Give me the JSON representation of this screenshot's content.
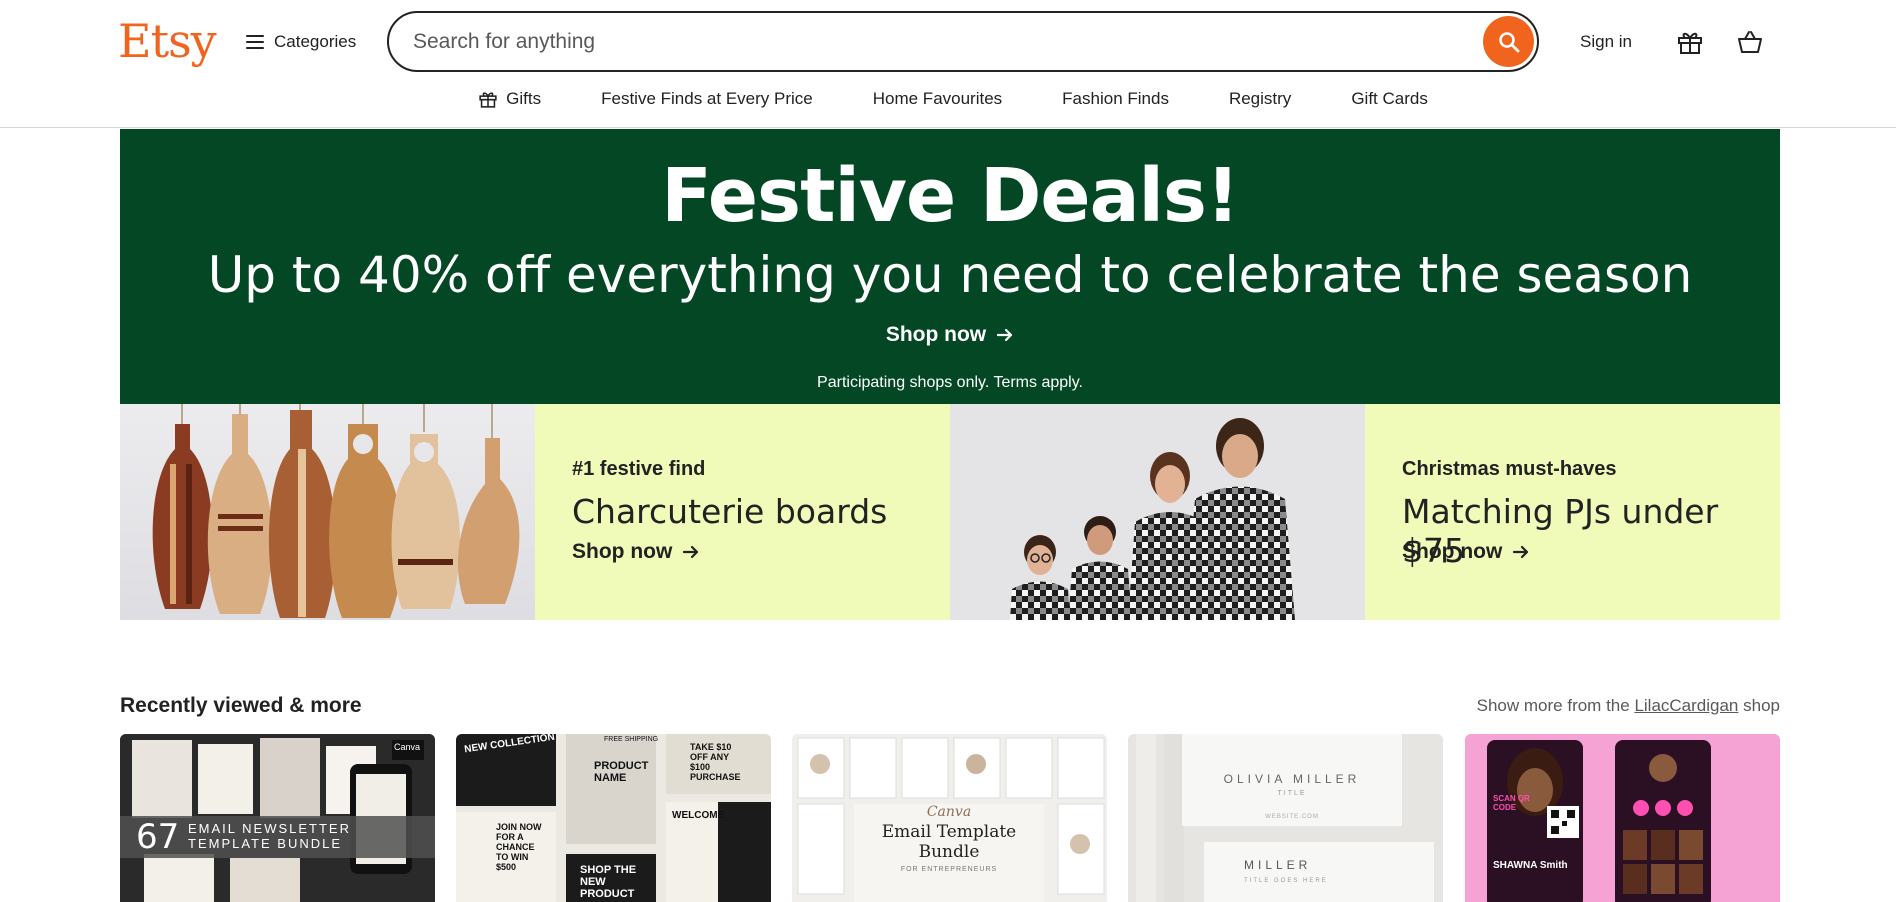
{
  "header": {
    "logo": "Etsy",
    "categories_label": "Categories",
    "search_placeholder": "Search for anything",
    "sign_in_label": "Sign in"
  },
  "nav": {
    "items": [
      {
        "label": "Gifts",
        "icon": "gift-icon"
      },
      {
        "label": "Festive Finds at Every Price"
      },
      {
        "label": "Home Favourites"
      },
      {
        "label": "Fashion Finds"
      },
      {
        "label": "Registry"
      },
      {
        "label": "Gift Cards"
      }
    ]
  },
  "hero": {
    "title": "Festive Deals!",
    "subtitle": "Up to 40% off everything you need to celebrate the season",
    "cta": "Shop now",
    "note": "Participating shops only. Terms apply."
  },
  "promos": [
    {
      "kicker": "#1 festive find",
      "title": "Charcuterie boards",
      "cta": "Shop now"
    },
    {
      "kicker": "Christmas must-haves",
      "title": "Matching PJs under $75",
      "cta": "Shop now"
    }
  ],
  "recently_viewed": {
    "title": "Recently viewed & more",
    "more_prefix": "Show more from the",
    "shop_name": "LilacCardigan",
    "more_suffix": "shop",
    "cards": [
      {
        "overlay_number": "67",
        "overlay_line1": "EMAIL NEWSLETTER",
        "overlay_line2": "TEMPLATE BUNDLE",
        "corner_text": "Canva"
      },
      {
        "header": "NEW COLLECTION",
        "text1": "PRODUCT NAME",
        "text2": "JOIN NOW FOR A CHANCE TO WIN $500",
        "text3": "SHOP THE NEW PRODUCT",
        "text4": "TAKE $10 OFF ANY $100 PURCHASE",
        "text5": "WELCOME",
        "text6": "FREE SHIPPING"
      },
      {
        "brand": "Canva",
        "title_line1": "Email Template",
        "title_line2": "Bundle",
        "subtitle": "FOR ENTREPRENEURS"
      },
      {
        "name": "OLIVIA MILLER",
        "role": "TITLE",
        "website": "WEBSITE.COM",
        "name2": "MILLER",
        "role2": "TITLE GOES HERE"
      },
      {
        "name": "SHAWNA Smith",
        "scan_text": "SCAN QR CODE"
      }
    ]
  },
  "colors": {
    "brand": "#f1641e",
    "hero_bg": "#034725",
    "promo_bg": "#f1fbb9"
  }
}
